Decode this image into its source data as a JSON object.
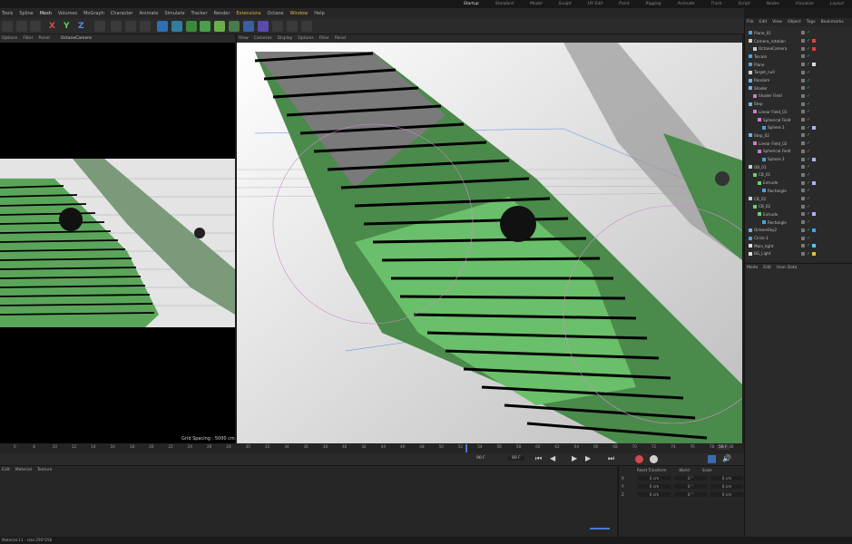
{
  "layouts": [
    "Startup",
    "Standard",
    "Model",
    "Sculpt",
    "UV Edit",
    "Paint",
    "Rigging",
    "Animate",
    "Track",
    "Script",
    "Nodes",
    "Visualize",
    "Layout"
  ],
  "menu": [
    "Tools",
    "Spline",
    "Mesh",
    "Volumes",
    "MoGraph",
    "Character",
    "Animate",
    "Simulate",
    "Tracker",
    "Render",
    "Extensions",
    "Octane",
    "Window",
    "Help"
  ],
  "toolbar_axes": [
    "X",
    "Y",
    "Z"
  ],
  "left_viewport": {
    "menu": [
      "Options",
      "Filter",
      "Panel"
    ],
    "camera": "OctaneCamera",
    "grid_spacing": "Grid Spacing : 5000 cm"
  },
  "right_viewport": {
    "menu": [
      "View",
      "Cameras",
      "Display",
      "Options",
      "Filter",
      "Panel"
    ]
  },
  "object_manager": {
    "menu": [
      "File",
      "Edit",
      "View",
      "Object",
      "Tags",
      "Bookmarks"
    ],
    "objects": [
      {
        "name": "Plane_01",
        "indent": 0,
        "icon": "plane-icon",
        "color": "#4aa0e0",
        "tag": ""
      },
      {
        "name": "Camera_rotation",
        "indent": 0,
        "icon": "null-icon",
        "color": "#cccccc",
        "tag": "red"
      },
      {
        "name": "OctaneCamera",
        "indent": 1,
        "icon": "camera-icon",
        "color": "#cccccc",
        "tag": "red"
      },
      {
        "name": "Terrain",
        "indent": 0,
        "icon": "plane-icon",
        "color": "#4aa0e0",
        "tag": ""
      },
      {
        "name": "Plane",
        "indent": 0,
        "icon": "plane-icon",
        "color": "#4aa0e0",
        "tag": "checker"
      },
      {
        "name": "Target_null",
        "indent": 0,
        "icon": "null-icon",
        "color": "#cccccc",
        "tag": ""
      },
      {
        "name": "Random",
        "indent": 0,
        "icon": "random-icon",
        "color": "#6cb0e8",
        "tag": ""
      },
      {
        "name": "Shader",
        "indent": 0,
        "icon": "shader-icon",
        "color": "#6cb0e8",
        "tag": ""
      },
      {
        "name": "Shader Field",
        "indent": 1,
        "icon": "field-icon",
        "color": "#c880c8",
        "tag": ""
      },
      {
        "name": "Step",
        "indent": 0,
        "icon": "step-icon",
        "color": "#6cb0e8",
        "tag": ""
      },
      {
        "name": "Linear Field_01",
        "indent": 1,
        "icon": "field-icon",
        "color": "#c880c8",
        "tag": ""
      },
      {
        "name": "Spherical Field",
        "indent": 2,
        "icon": "field-icon",
        "color": "#c880c8",
        "tag": ""
      },
      {
        "name": "Sphere.1",
        "indent": 3,
        "icon": "sphere-icon",
        "color": "#4aa0e0",
        "tag": "flag"
      },
      {
        "name": "Step_02",
        "indent": 0,
        "icon": "step-icon",
        "color": "#6cb0e8",
        "tag": ""
      },
      {
        "name": "Linear Field_02",
        "indent": 1,
        "icon": "field-icon",
        "color": "#c880c8",
        "tag": ""
      },
      {
        "name": "Spherical Field",
        "indent": 2,
        "icon": "field-icon",
        "color": "#c880c8",
        "tag": ""
      },
      {
        "name": "Sphere.1",
        "indent": 3,
        "icon": "sphere-icon",
        "color": "#4aa0e0",
        "tag": "flag"
      },
      {
        "name": "OB_01",
        "indent": 0,
        "icon": "null-icon",
        "color": "#cccccc",
        "tag": ""
      },
      {
        "name": "CB_01",
        "indent": 1,
        "icon": "cloner-icon",
        "color": "#6cd06c",
        "tag": ""
      },
      {
        "name": "Extrude",
        "indent": 2,
        "icon": "extrude-icon",
        "color": "#6cd06c",
        "tag": "flag"
      },
      {
        "name": "Rectangle",
        "indent": 3,
        "icon": "rectangle-icon",
        "color": "#4aa0e0",
        "tag": ""
      },
      {
        "name": "CB_02",
        "indent": 0,
        "icon": "null-icon",
        "color": "#cccccc",
        "tag": ""
      },
      {
        "name": "CB_02",
        "indent": 1,
        "icon": "cloner-icon",
        "color": "#6cd06c",
        "tag": ""
      },
      {
        "name": "Extrude",
        "indent": 2,
        "icon": "extrude-icon",
        "color": "#6cd06c",
        "tag": "flag"
      },
      {
        "name": "Rectangle",
        "indent": 3,
        "icon": "rectangle-icon",
        "color": "#4aa0e0",
        "tag": ""
      },
      {
        "name": "OctaneSky2",
        "indent": 0,
        "icon": "sky-icon",
        "color": "#6cb0e8",
        "tag": "blue"
      },
      {
        "name": "Circle.1",
        "indent": 0,
        "icon": "circle-icon",
        "color": "#4aa0e0",
        "tag": ""
      },
      {
        "name": "Main_light",
        "indent": 0,
        "icon": "light-icon",
        "color": "#e0e0e0",
        "tag": "multi"
      },
      {
        "name": "BG_Light",
        "indent": 0,
        "icon": "light-icon",
        "color": "#e0e0e0",
        "tag": "yellow"
      }
    ]
  },
  "attribute_manager": {
    "menu": [
      "Mode",
      "Edit",
      "User Data"
    ]
  },
  "timeline": {
    "ticks": [
      "0",
      "8",
      "10",
      "12",
      "14",
      "16",
      "18",
      "20",
      "22",
      "24",
      "26",
      "28",
      "30",
      "32",
      "34",
      "36",
      "38",
      "40",
      "42",
      "44",
      "46",
      "48",
      "50",
      "52",
      "54",
      "56",
      "58",
      "60",
      "62",
      "64",
      "66",
      "68",
      "70",
      "72",
      "74",
      "76",
      "78",
      "80"
    ],
    "current_frame": "56 F",
    "start_frame": "90 F",
    "end_frame": "80 F"
  },
  "material_manager": {
    "menu": [
      "Edit",
      "Material",
      "Texture"
    ]
  },
  "coordinates": {
    "headers": [
      "Reset Transform",
      "World",
      "Scale"
    ],
    "rows": [
      {
        "axis": "X",
        "p": "0 cm",
        "r": "0 °",
        "s": "0 cm"
      },
      {
        "axis": "Y",
        "p": "0 cm",
        "r": "0 °",
        "s": "0 cm"
      },
      {
        "axis": "Z",
        "p": "0 cm",
        "r": "0 °",
        "s": "0 cm"
      }
    ]
  },
  "status": "Material.11 · size:256*256"
}
